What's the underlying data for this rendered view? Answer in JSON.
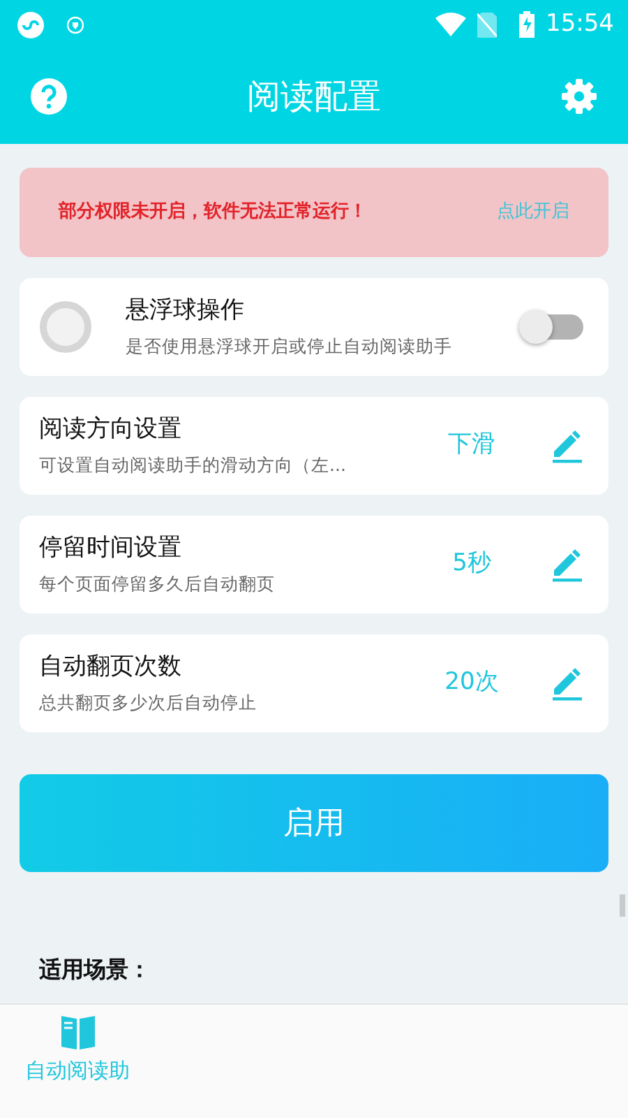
{
  "status_bar": {
    "time": "15:54"
  },
  "header": {
    "title": "阅读配置"
  },
  "alert": {
    "message": "部分权限未开启，软件无法正常运行！",
    "action": "点此开启"
  },
  "float_ball": {
    "title": "悬浮球操作",
    "subtitle": "是否使用悬浮球开启或停止自动阅读助手",
    "on": false
  },
  "settings": [
    {
      "title": "阅读方向设置",
      "subtitle": "可设置自动阅读助手的滑动方向（左...",
      "value": "下滑"
    },
    {
      "title": "停留时间设置",
      "subtitle": "每个页面停留多久后自动翻页",
      "value": "5秒"
    },
    {
      "title": "自动翻页次数",
      "subtitle": "总共翻页多少次后自动停止",
      "value": "20次"
    }
  ],
  "enable_button": "启用",
  "scenes_heading": "适用场景：",
  "bottom_tabs": [
    {
      "label": "自动阅读助",
      "selected": true
    }
  ]
}
